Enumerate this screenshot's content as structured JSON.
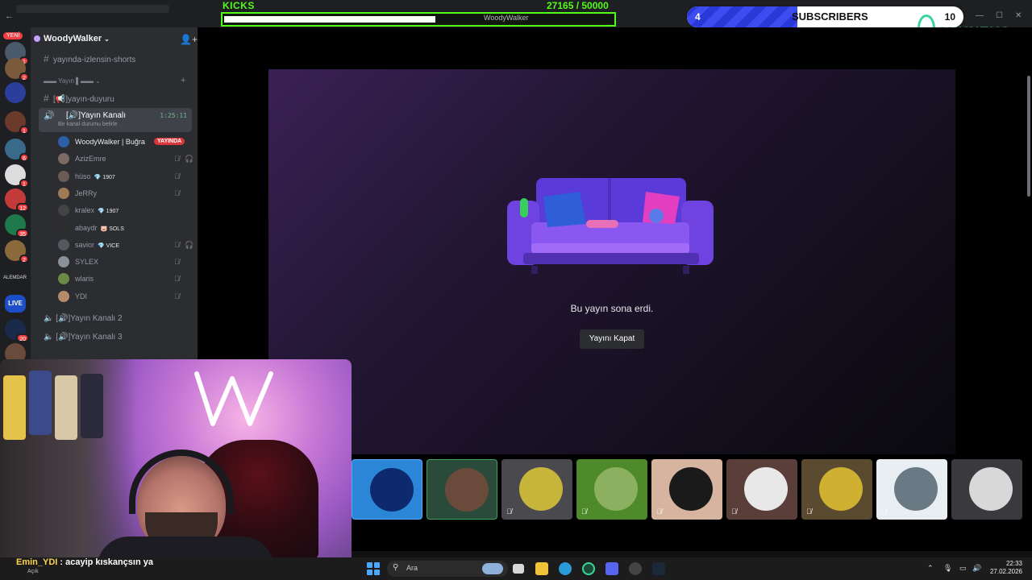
{
  "overlay": {
    "kicks_label": "KICKS",
    "kicks_progress": "27165 / 50000",
    "kicks_fraction": 0.5433,
    "kicks_name": "WoodyWalker",
    "subs_count": "4",
    "subs_label": "SUBSCRIBERS",
    "subs_goal": "10",
    "subs_fraction": 0.4,
    "brand_logo": "OYUNEKS"
  },
  "rail": {
    "new_label": "YENİ",
    "badges": [
      "1",
      "2",
      "1",
      "6",
      "1",
      "12",
      "35",
      "2",
      "20"
    ],
    "text_tile": "ALEMDAR",
    "live_tile": "LIVE"
  },
  "sidebar": {
    "server_name": "WoodyWalker",
    "channels": [
      "yayında-izlensin-shorts"
    ],
    "category": "Yayın",
    "text_channel": "[📢]yayın-duyuru",
    "active_voice": {
      "name": "[🔊]Yayın Kanalı",
      "status": "Bir kanal durumu belirle",
      "time": "1:25:11"
    },
    "members": [
      {
        "name": "WoodyWalker | Buğra",
        "badge": "YAYINDA",
        "color": "#2e5fa8",
        "live": true
      },
      {
        "name": "AzizEmre",
        "badge": "",
        "color": "#7d6a64"
      },
      {
        "name": "hüso",
        "badge": "💎 1907",
        "color": "#6b5a55"
      },
      {
        "name": "JeRRy",
        "badge": "",
        "color": "#a07a55"
      },
      {
        "name": "kralex",
        "badge": "💎 1907",
        "color": "#444"
      },
      {
        "name": "abaydr",
        "badge": "🐷 SOLS",
        "color": "#2d2d2d"
      },
      {
        "name": "savior",
        "badge": "💎 VICE",
        "color": "#55595f"
      },
      {
        "name": "SYLEX",
        "badge": "",
        "color": "#8a9198"
      },
      {
        "name": "wlaris",
        "badge": "",
        "color": "#6c8a45"
      },
      {
        "name": "YDI",
        "badge": "",
        "color": "#b48c6b"
      }
    ],
    "voice_2": "[🔊]Yayın Kanalı 2",
    "voice_3": "[🔊]Yayın Kanalı 3"
  },
  "stream": {
    "ended_text": "Bu yayın sona erdi.",
    "close_button": "Yayını Kapat"
  },
  "tiles": [
    {
      "bg": "#2c86d8",
      "av": "#0d2a6e",
      "muted": false,
      "border": "#58a6ff"
    },
    {
      "bg": "#2a4a3a",
      "av": "#6a4a3a",
      "muted": false,
      "border": "#3ba55d"
    },
    {
      "bg": "#4a4a4e",
      "av": "#c7b43a",
      "muted": true
    },
    {
      "bg": "#4f8a2a",
      "av": "#8bb060",
      "muted": true
    },
    {
      "bg": "#d6b4a0",
      "av": "#1a1a1a",
      "muted": true
    },
    {
      "bg": "#5a3e3a",
      "av": "#e8e8e8",
      "muted": true
    },
    {
      "bg": "#5a4a30",
      "av": "#d0b030",
      "muted": true
    },
    {
      "bg": "#e8eef2",
      "av": "#6a7a84",
      "muted": true
    },
    {
      "bg": "#3a3a3e",
      "av": "#d8d8d8",
      "muted": false
    }
  ],
  "chat": {
    "user": "Emin_YDI",
    "message": " : acayip kıskançsın ya",
    "sub": "Açık"
  },
  "taskbar": {
    "search_label": "Ara",
    "time": "22:33",
    "date": "27.02.2026"
  }
}
